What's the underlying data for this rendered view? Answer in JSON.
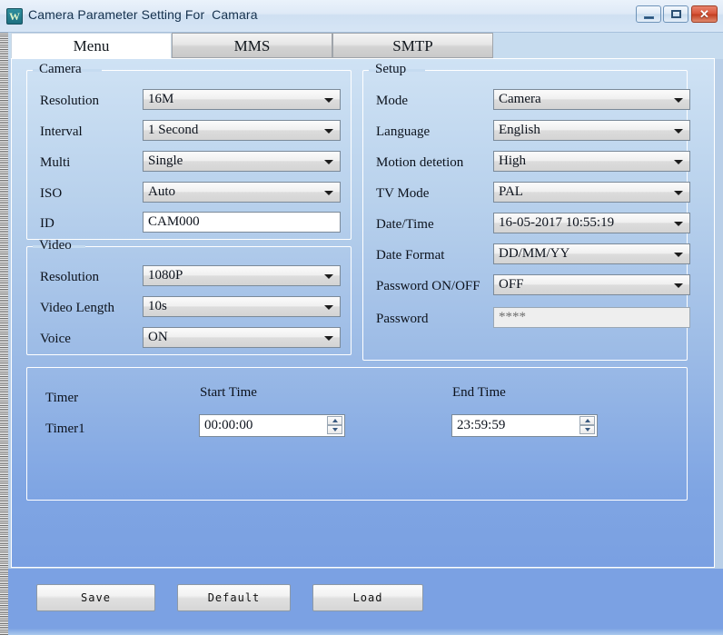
{
  "window": {
    "title": "Camera Parameter Setting For  Camara",
    "icon": "app-logo-icon",
    "icon_glyph": "W",
    "controls": {
      "minimize": "minimize-icon",
      "maximize": "maximize-icon",
      "close_glyph": "✕"
    }
  },
  "tabs": [
    {
      "label": "Menu",
      "active": true
    },
    {
      "label": "MMS",
      "active": false
    },
    {
      "label": "SMTP",
      "active": false
    }
  ],
  "camera": {
    "title": "Camera",
    "fields": [
      {
        "label": "Resolution",
        "value": "16M",
        "type": "combo"
      },
      {
        "label": "Interval",
        "value": "1 Second",
        "type": "combo"
      },
      {
        "label": "Multi",
        "value": "Single",
        "type": "combo"
      },
      {
        "label": "ISO",
        "value": "Auto",
        "type": "combo"
      },
      {
        "label": "ID",
        "value": "CAM000",
        "type": "text"
      }
    ]
  },
  "video": {
    "title": "Video",
    "fields": [
      {
        "label": "Resolution",
        "value": "1080P",
        "type": "combo"
      },
      {
        "label": "Video Length",
        "value": "10s",
        "type": "combo"
      },
      {
        "label": "Voice",
        "value": "ON",
        "type": "combo"
      }
    ]
  },
  "setup": {
    "title": "Setup",
    "fields": [
      {
        "label": "Mode",
        "value": "Camera",
        "type": "combo"
      },
      {
        "label": "Language",
        "value": "English",
        "type": "combo"
      },
      {
        "label": "Motion detetion",
        "value": "High",
        "type": "combo"
      },
      {
        "label": "TV Mode",
        "value": "PAL",
        "type": "combo"
      },
      {
        "label": "Date/Time",
        "value": "16-05-2017 10:55:19",
        "type": "combo"
      },
      {
        "label": "Date Format",
        "value": "DD/MM/YY",
        "type": "combo"
      },
      {
        "label": "Password ON/OFF",
        "value": "OFF",
        "type": "combo"
      },
      {
        "label": "Password",
        "value": "****",
        "type": "text_disabled"
      }
    ]
  },
  "timer": {
    "header_label": "Timer",
    "start_col": "Start Time",
    "end_col": "End Time",
    "rows": [
      {
        "label": "Timer1",
        "start": "00:00:00",
        "end": "23:59:59"
      }
    ]
  },
  "footer": {
    "save": "Save",
    "default": "Default",
    "load": "Load"
  },
  "colors": {
    "titlebar": "#dfeaf7",
    "close_button": "#d9573c",
    "panel_top": "#cfe2f4",
    "panel_bottom": "#7aa0e2",
    "footer": "#7ba1e3"
  }
}
